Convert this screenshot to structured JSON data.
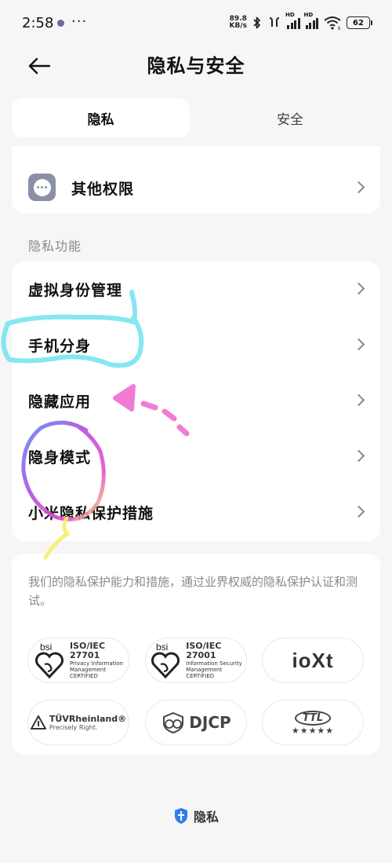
{
  "status_bar": {
    "time": "2:58",
    "more": "···",
    "net_speed_value": "89.8",
    "net_speed_unit": "KB/s",
    "signal_tag_1": "HD",
    "signal_tag_2": "HD",
    "wifi_tag": "6",
    "battery": "62"
  },
  "header": {
    "title": "隐私与安全"
  },
  "tabs": [
    {
      "label": "隐私",
      "selected": true
    },
    {
      "label": "安全",
      "selected": false
    }
  ],
  "other_permissions": {
    "label": "其他权限"
  },
  "section": {
    "title": "隐私功能"
  },
  "features": [
    {
      "label": "虚拟身份管理"
    },
    {
      "label": "手机分身"
    },
    {
      "label": "隐藏应用"
    },
    {
      "label": "隐身模式"
    },
    {
      "label": "小米隐私保护措施"
    }
  ],
  "cert": {
    "description": "我们的隐私保护能力和措施，通过业界权威的隐私保护认证和测试。",
    "badges": {
      "bsi1_brand": "bsi",
      "bsi1_std": "ISO/IEC",
      "bsi1_num": "27701",
      "bsi1_desc1": "Privacy Information",
      "bsi1_desc2": "Management",
      "bsi1_cert": "CERTIFIED",
      "bsi2_brand": "bsi",
      "bsi2_std": "ISO/IEC",
      "bsi2_num": "27001",
      "bsi2_desc1": "Information Security",
      "bsi2_desc2": "Management",
      "bsi2_cert": "CERTIFIED",
      "ioxt": "ioXt",
      "tuv_name": "TÜVRheinland®",
      "tuv_tagline": "Precisely Right.",
      "djcp": "DJCP",
      "ttl": "TTL",
      "ttl_stars": "★★★★★"
    }
  },
  "footer": {
    "label": "隐私"
  },
  "colors": {
    "background": "#f6f6f6",
    "card": "#ffffff",
    "icon_gray": "#8c8fa8",
    "footer_icon_blue": "#2d7cf0",
    "doodle_cyan": "#6fe3f0",
    "doodle_pink": "#f06ed0"
  }
}
